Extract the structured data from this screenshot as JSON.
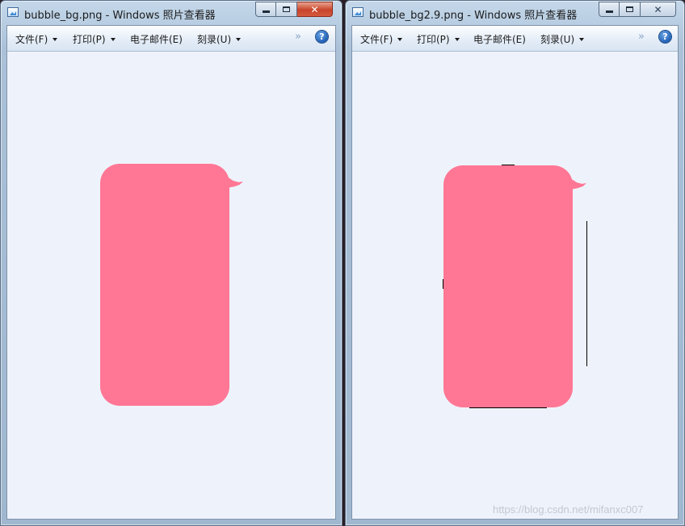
{
  "windows": [
    {
      "title": "bubble_bg.png - Windows 照片查看器",
      "menu": [
        "文件(F)",
        "打印(P)",
        "电子邮件(E)",
        "刻录(U)"
      ],
      "overflow": "»",
      "help": "?"
    },
    {
      "title": "bubble_bg2.9.png - Windows 照片查看器",
      "menu": [
        "文件(F)",
        "打印(P)",
        "电子邮件(E)",
        "刻录(U)"
      ],
      "overflow": "»",
      "help": "?"
    }
  ],
  "bubble_color": "#ff7795",
  "watermark": "https://blog.csdn.net/mifanxc007"
}
